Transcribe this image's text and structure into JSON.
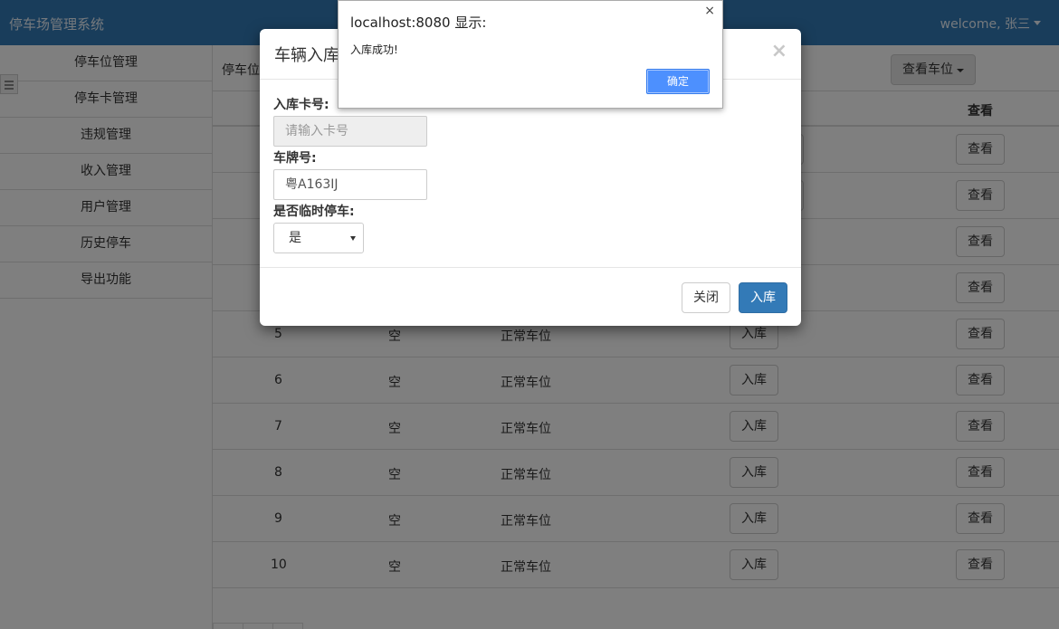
{
  "navbar": {
    "brand": "停车场管理系统",
    "welcome": "welcome, 张三"
  },
  "sidebar": {
    "items": [
      {
        "label": "停车位管理"
      },
      {
        "label": "停车卡管理"
      },
      {
        "label": "违规管理"
      },
      {
        "label": "收入管理"
      },
      {
        "label": "用户管理"
      },
      {
        "label": "历史停车"
      },
      {
        "label": "导出功能"
      }
    ]
  },
  "main": {
    "title": "停车位",
    "view_button": "查看车位",
    "table": {
      "header_view": "查看",
      "rows": [
        {
          "no": "5",
          "status": "空",
          "type": "正常车位",
          "action": "入库",
          "view": "查看"
        },
        {
          "no": "6",
          "status": "空",
          "type": "正常车位",
          "action": "入库",
          "view": "查看"
        },
        {
          "no": "7",
          "status": "空",
          "type": "正常车位",
          "action": "入库",
          "view": "查看"
        },
        {
          "no": "8",
          "status": "空",
          "type": "正常车位",
          "action": "入库",
          "view": "查看"
        },
        {
          "no": "9",
          "status": "空",
          "type": "正常车位",
          "action": "入库",
          "view": "查看"
        },
        {
          "no": "10",
          "status": "空",
          "type": "正常车位",
          "action": "入库",
          "view": "查看"
        }
      ],
      "hidden_view_buttons": [
        "查看",
        "查看",
        "查看",
        "查看"
      ]
    }
  },
  "modal": {
    "title": "车辆入库",
    "close_symbol": "×",
    "card_label": "入库卡号:",
    "card_placeholder": "请输入卡号",
    "plate_label": "车牌号:",
    "plate_value": "粤A163IJ",
    "temp_label": "是否临时停车:",
    "temp_value": "是",
    "close_button": "关闭",
    "submit_button": "入库"
  },
  "alert": {
    "title": "localhost:8080 显示:",
    "message": "入库成功!",
    "ok_button": "确定",
    "close_symbol": "×"
  },
  "colors": {
    "primary": "#337ab7",
    "alert_ok": "#4d90fe"
  }
}
